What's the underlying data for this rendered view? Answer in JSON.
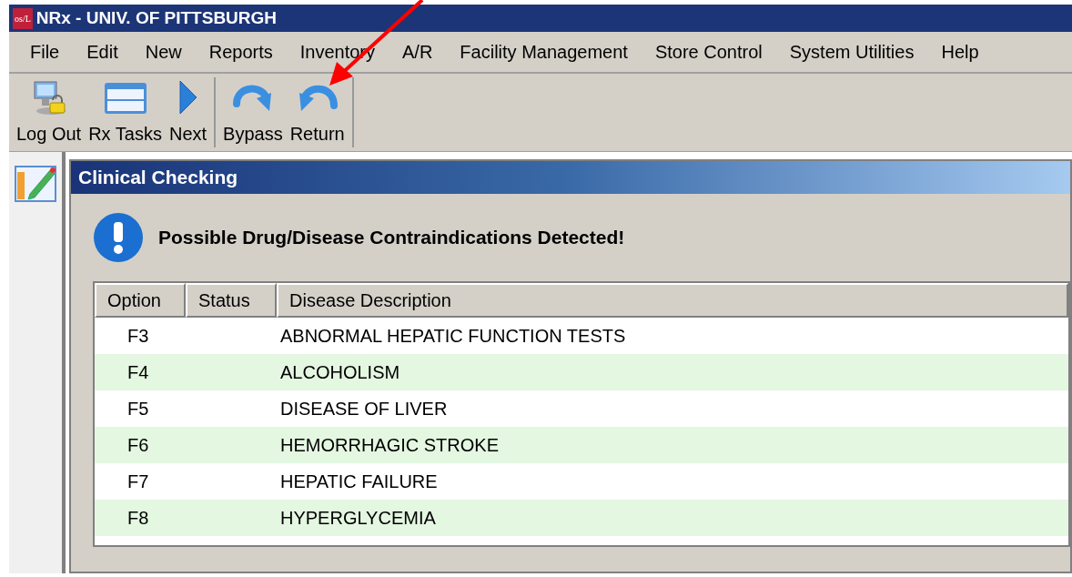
{
  "window": {
    "title": "NRx - UNIV. OF PITTSBURGH",
    "logo": "os/L"
  },
  "menu": [
    "File",
    "Edit",
    "New",
    "Reports",
    "Inventory",
    "A/R",
    "Facility Management",
    "Store Control",
    "System Utilities",
    "Help"
  ],
  "toolbar": [
    [
      {
        "label": "Log Out",
        "kind": "logout"
      },
      {
        "label": "Rx Tasks",
        "kind": "tasks"
      },
      {
        "label": "Next",
        "kind": "next"
      }
    ],
    [
      {
        "label": "Bypass",
        "kind": "bypass"
      },
      {
        "label": "Return",
        "kind": "return"
      }
    ]
  ],
  "dialog": {
    "title": "Clinical Checking",
    "message": "Possible Drug/Disease Contraindications Detected!"
  },
  "table": {
    "columns": [
      "Option",
      "Status",
      "Disease Description"
    ],
    "rows": [
      {
        "option": "F3",
        "description": "ABNORMAL HEPATIC FUNCTION TESTS"
      },
      {
        "option": "F4",
        "description": "ALCOHOLISM"
      },
      {
        "option": "F5",
        "description": "DISEASE OF LIVER"
      },
      {
        "option": "F6",
        "description": "HEMORRHAGIC STROKE"
      },
      {
        "option": "F7",
        "description": "HEPATIC FAILURE"
      },
      {
        "option": "F8",
        "description": "HYPERGLYCEMIA"
      }
    ]
  }
}
